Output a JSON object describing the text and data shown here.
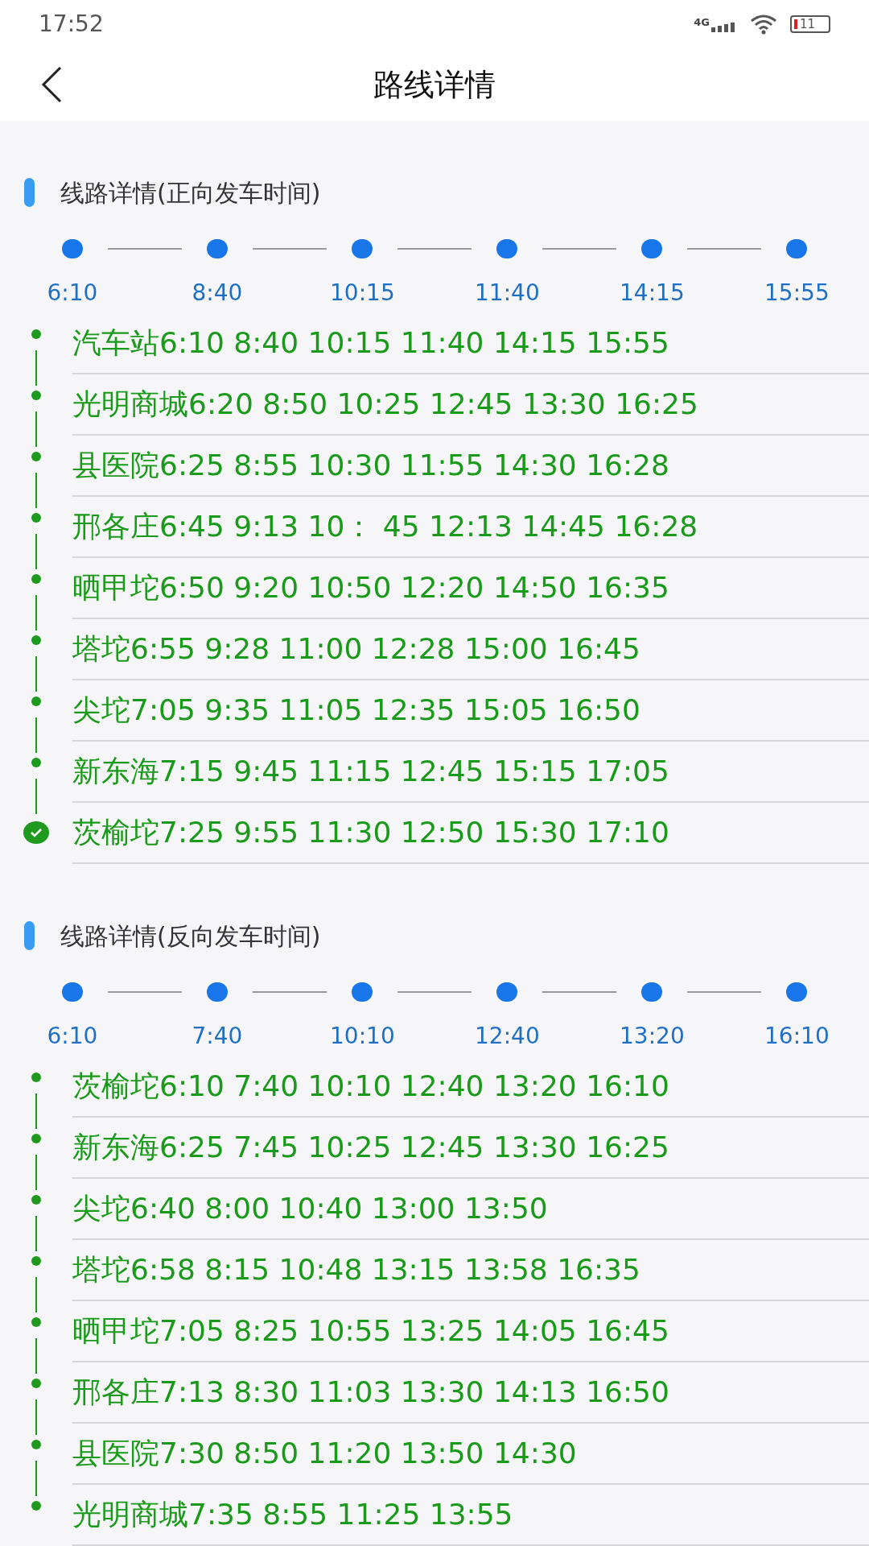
{
  "status_bar": {
    "time": "17:52",
    "network": "4G",
    "battery": "11"
  },
  "header": {
    "title": "路线详情"
  },
  "sections": [
    {
      "title": "线路详情(正向发车时间)",
      "departures": [
        "6:10",
        "8:40",
        "10:15",
        "11:40",
        "14:15",
        "15:55"
      ],
      "stops": [
        {
          "text": "汽车站6:10 8:40 10:15 11:40 14:15 15:55",
          "kind": "dot"
        },
        {
          "text": "光明商城6:20 8:50 10:25 12:45 13:30 16:25",
          "kind": "dot"
        },
        {
          "text": "县医院6:25 8:55 10:30 11:55 14:30 16:28",
          "kind": "dot"
        },
        {
          "text": "邢各庄6:45 9:13 10： 45 12:13 14:45 16:28",
          "kind": "dot"
        },
        {
          "text": "晒甲坨6:50 9:20 10:50 12:20 14:50 16:35",
          "kind": "dot"
        },
        {
          "text": "塔坨6:55 9:28 11:00 12:28 15:00 16:45",
          "kind": "dot"
        },
        {
          "text": "尖坨7:05 9:35 11:05 12:35 15:05 16:50",
          "kind": "dot"
        },
        {
          "text": "新东海7:15 9:45 11:15 12:45 15:15 17:05",
          "kind": "dot"
        },
        {
          "text": "茨榆坨7:25 9:55 11:30 12:50 15:30 17:10",
          "kind": "check"
        }
      ]
    },
    {
      "title": "线路详情(反向发车时间)",
      "departures": [
        "6:10",
        "7:40",
        "10:10",
        "12:40",
        "13:20",
        "16:10"
      ],
      "stops": [
        {
          "text": "茨榆坨6:10 7:40 10:10 12:40 13:20 16:10",
          "kind": "dot"
        },
        {
          "text": "新东海6:25 7:45 10:25 12:45 13:30 16:25",
          "kind": "dot"
        },
        {
          "text": "尖坨6:40 8:00 10:40 13:00 13:50",
          "kind": "dot"
        },
        {
          "text": "塔坨6:58 8:15 10:48 13:15 13:58 16:35",
          "kind": "dot"
        },
        {
          "text": "晒甲坨7:05 8:25 10:55 13:25 14:05 16:45",
          "kind": "dot"
        },
        {
          "text": "邢各庄7:13 8:30 11:03 13:30 14:13 16:50",
          "kind": "dot"
        },
        {
          "text": "县医院7:30 8:50 11:20 13:50 14:30",
          "kind": "dot"
        },
        {
          "text": "光明商城7:35 8:55 11:25 13:55",
          "kind": "dot"
        }
      ]
    }
  ]
}
